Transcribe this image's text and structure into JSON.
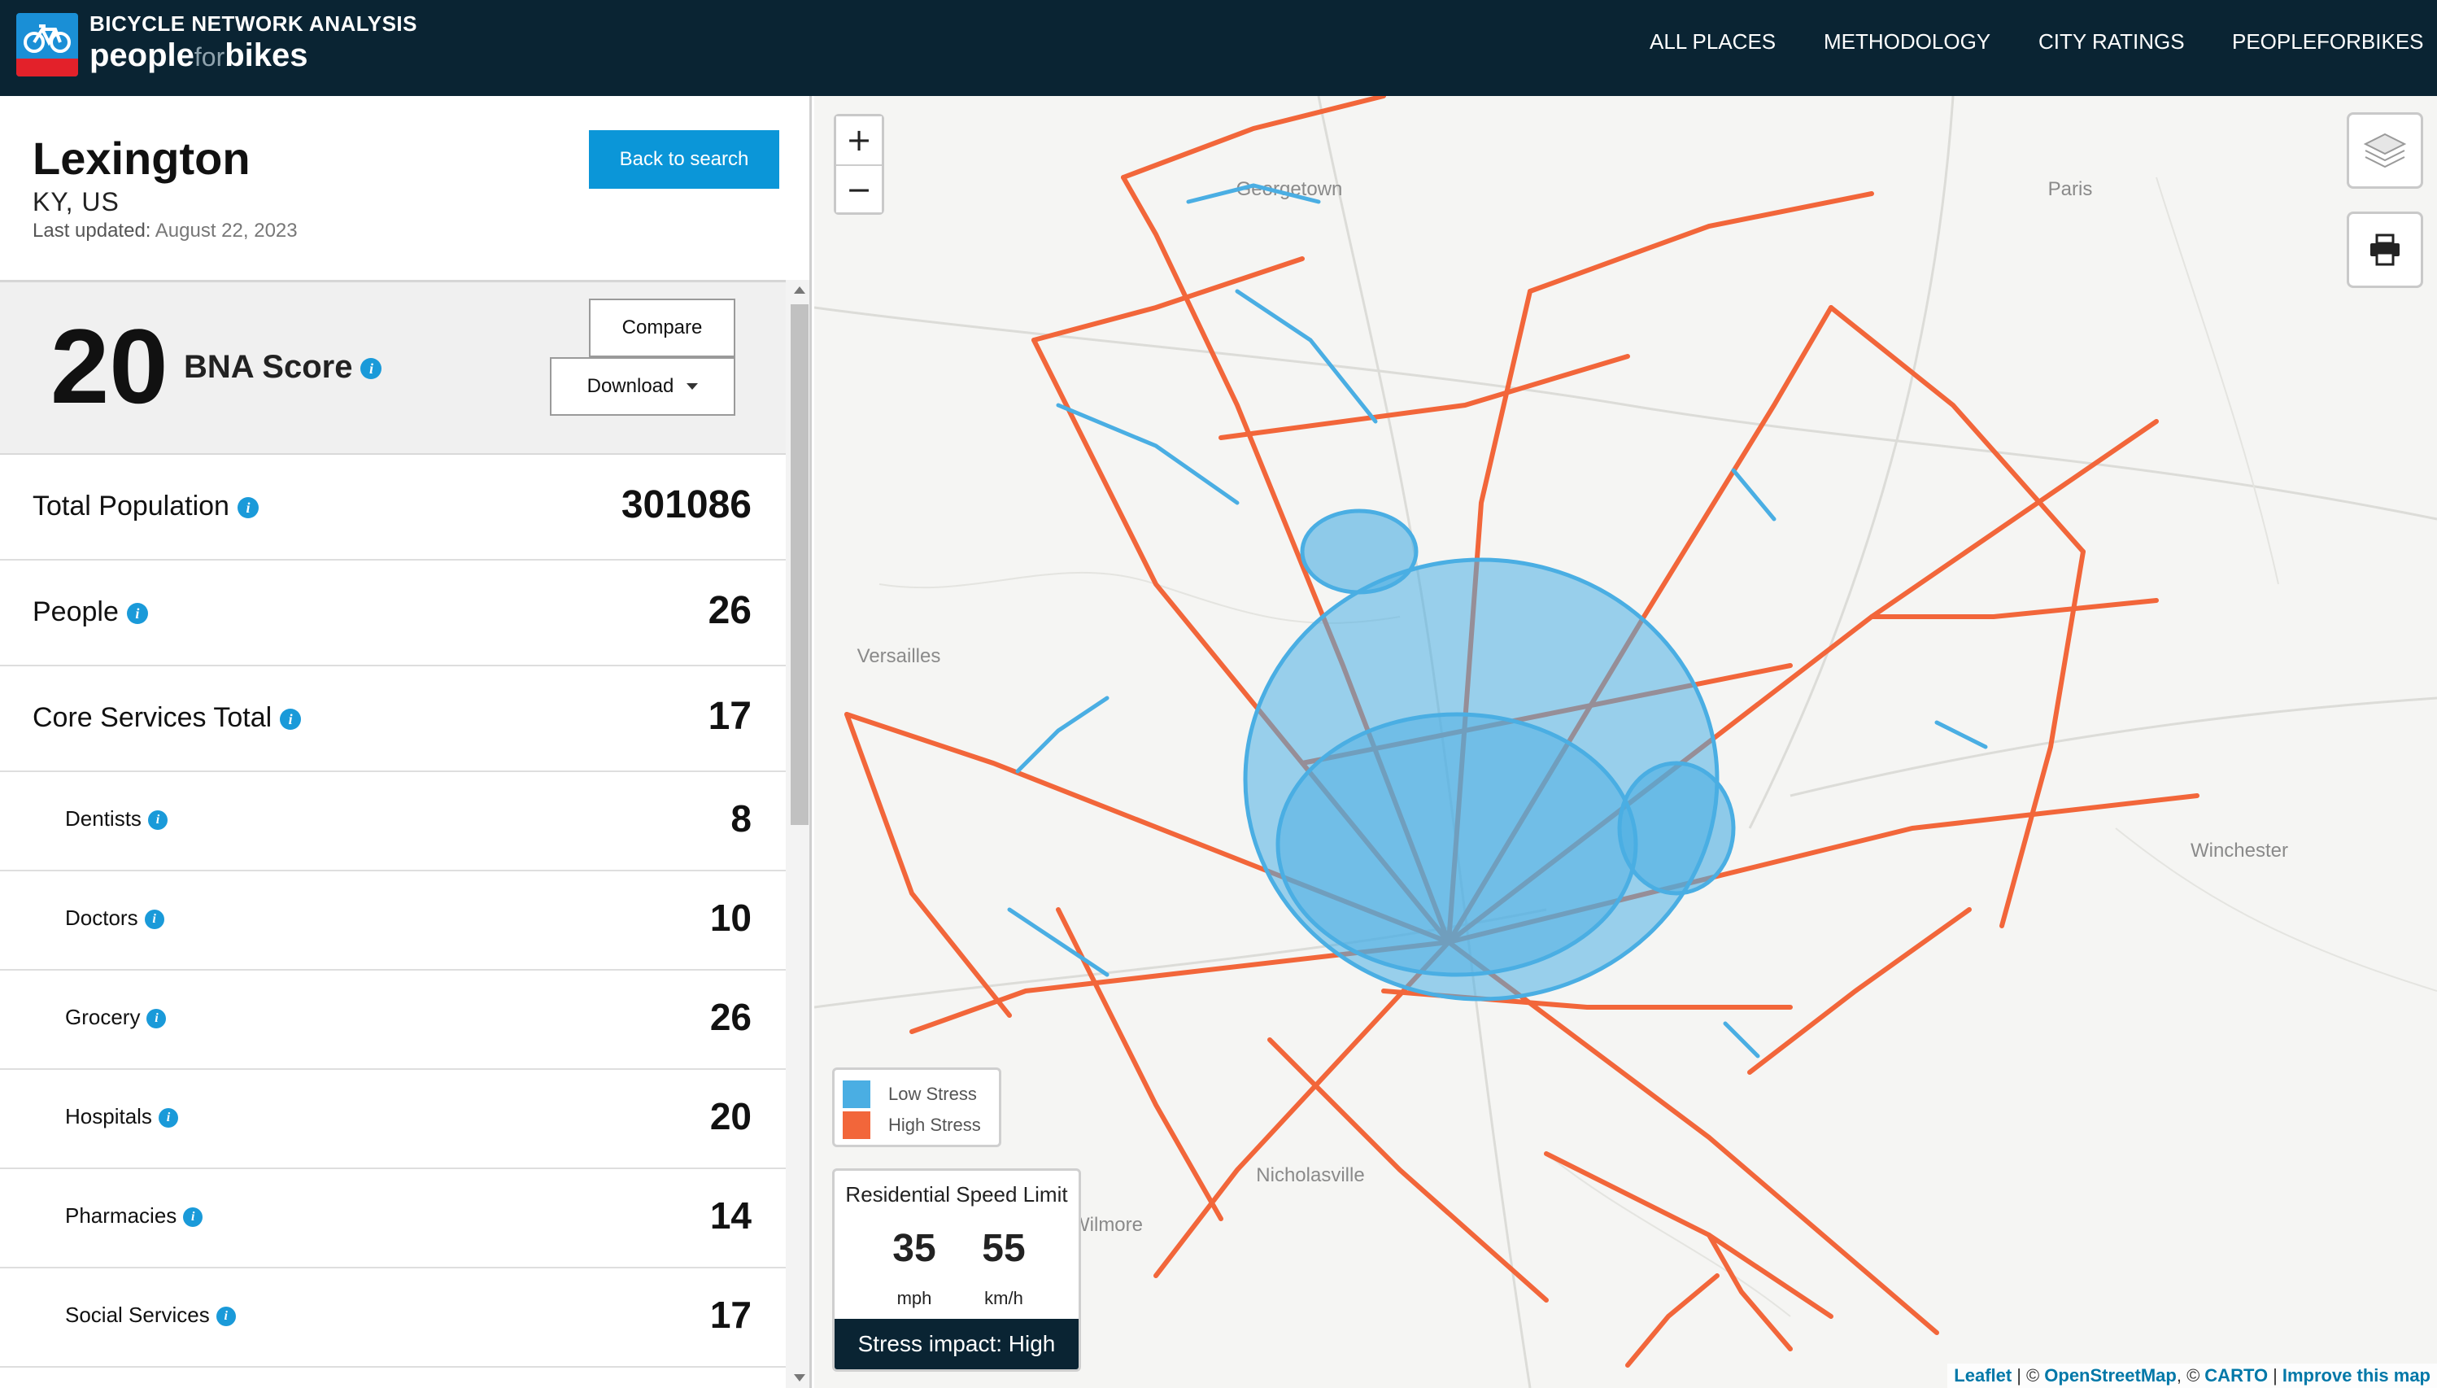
{
  "header": {
    "brand_top": "BICYCLE NETWORK ANALYSIS",
    "brand_people": "people",
    "brand_for": "for",
    "brand_bikes": "bikes",
    "nav": [
      "ALL PLACES",
      "METHODOLOGY",
      "CITY RATINGS",
      "PEOPLEFORBIKES"
    ]
  },
  "place": {
    "name": "Lexington",
    "region": "KY, US",
    "updated_label": "Last updated:",
    "updated_value": "August 22, 2023",
    "back_label": "Back to search"
  },
  "score": {
    "value": "20",
    "label": "BNA Score",
    "compare_label": "Compare",
    "download_label": "Download"
  },
  "metrics": [
    {
      "label": "Total Population",
      "value": "301086"
    },
    {
      "label": "People",
      "value": "26"
    },
    {
      "label": "Core Services Total",
      "value": "17"
    }
  ],
  "submetrics": [
    {
      "label": "Dentists",
      "value": "8"
    },
    {
      "label": "Doctors",
      "value": "10"
    },
    {
      "label": "Grocery",
      "value": "26"
    },
    {
      "label": "Hospitals",
      "value": "20"
    },
    {
      "label": "Pharmacies",
      "value": "14"
    },
    {
      "label": "Social Services",
      "value": "17"
    }
  ],
  "map": {
    "places": [
      "Georgetown",
      "Paris",
      "Versailles",
      "Winchester",
      "Nicholasville",
      "Wilmore"
    ],
    "zoom_in": "+",
    "zoom_out": "−",
    "legend": {
      "low": "Low Stress",
      "high": "High Stress",
      "low_color": "#4aaee3",
      "high_color": "#f2663a"
    },
    "speed": {
      "title": "Residential Speed Limit",
      "mph": "35",
      "mph_unit": "mph",
      "kmh": "55",
      "kmh_unit": "km/h",
      "stress": "Stress impact: High"
    },
    "attribution": {
      "leaflet": "Leaflet",
      "sep1": "| ©",
      "osm": "OpenStreetMap",
      "sep2": ", ©",
      "carto": "CARTO",
      "sep3": "|",
      "improve": "Improve this map"
    }
  },
  "colors": {
    "header_bg": "#0a2433",
    "accent_blue": "#0b96d8",
    "low_stress": "#4aaee3",
    "high_stress": "#f2663a"
  }
}
